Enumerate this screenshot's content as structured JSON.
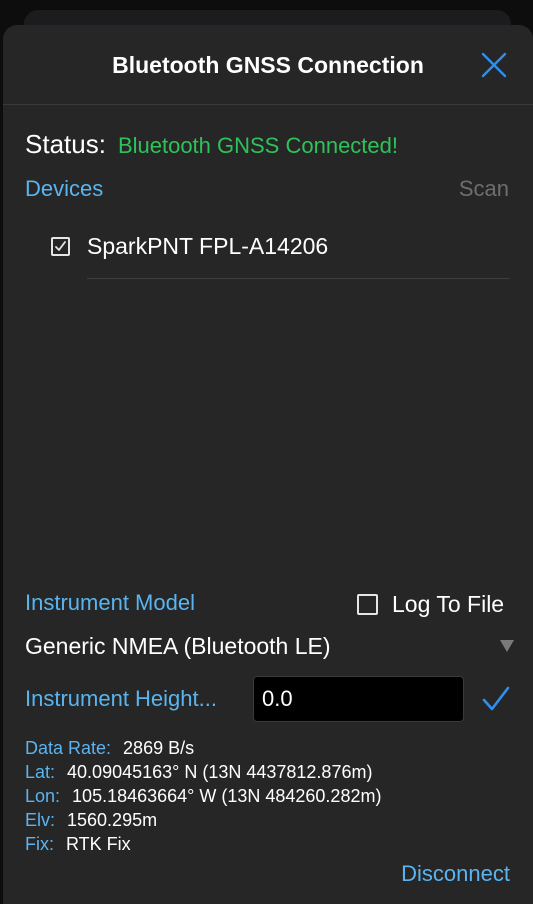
{
  "header": {
    "title": "Bluetooth GNSS Connection",
    "close_icon": "close-x-icon"
  },
  "status": {
    "label": "Status:",
    "value": "Bluetooth GNSS Connected!",
    "value_color": "#2ec25a"
  },
  "devices": {
    "label": "Devices",
    "scan_label": "Scan",
    "items": [
      {
        "name": "SparkPNT FPL-A14206",
        "checked": true
      }
    ]
  },
  "instrument": {
    "model_label": "Instrument Model",
    "log_label": "Log To File",
    "log_checked": false,
    "model_value": "Generic NMEA (Bluetooth LE)",
    "height_label": "Instrument Height...",
    "height_value": "0.0"
  },
  "info": {
    "data_rate_label": "Data Rate:",
    "data_rate_value": "2869 B/s",
    "lat_label": "Lat:",
    "lat_value": "40.09045163° N (13N 4437812.876m)",
    "lon_label": "Lon:",
    "lon_value": "105.18463664° W (13N 484260.282m)",
    "elv_label": "Elv:",
    "elv_value": "1560.295m",
    "fix_label": "Fix:",
    "fix_value": "RTK Fix"
  },
  "footer": {
    "disconnect_label": "Disconnect"
  },
  "colors": {
    "accent": "#5ab4f0",
    "success": "#2ec25a",
    "background": "#262626"
  }
}
